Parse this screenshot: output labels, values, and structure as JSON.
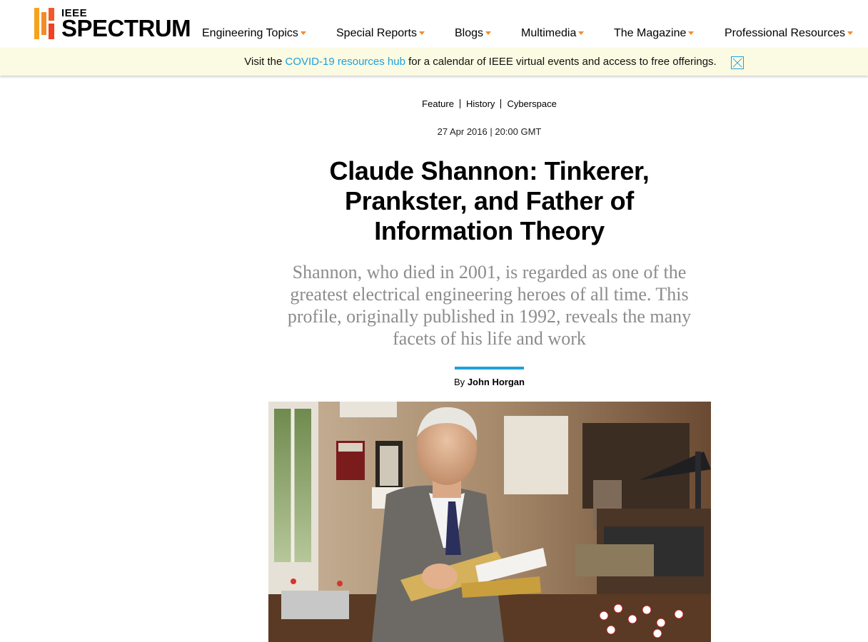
{
  "brand": {
    "small": "IEEE",
    "big": "SPECTRUM"
  },
  "nav": {
    "items": [
      {
        "label": "Engineering Topics"
      },
      {
        "label": "Special Reports"
      },
      {
        "label": "Blogs"
      },
      {
        "label": "Multimedia"
      },
      {
        "label": "The Magazine"
      },
      {
        "label": "Professional Resources"
      }
    ]
  },
  "banner": {
    "prefix": "Visit the ",
    "link": "COVID-19 resources hub",
    "suffix": " for a calendar of IEEE virtual events and access to free offerings."
  },
  "article": {
    "tags": [
      "Feature",
      "History",
      "Cyberspace"
    ],
    "date": "27 Apr 2016 | 20:00 GMT",
    "title": "Claude Shannon: Tinkerer, Prankster, and Father of Information Theory",
    "dek": "Shannon, who died in 2001, is regarded as one of the greatest electrical engineering heroes of all time. This profile, originally published in 1992, reveals the many facets of his life and work",
    "byline_prefix": "By",
    "author": "John Horgan"
  },
  "colors": {
    "accent": "#1fa0dc",
    "brand_orange": "#f38a2b",
    "banner_bg": "#fbfae2"
  }
}
